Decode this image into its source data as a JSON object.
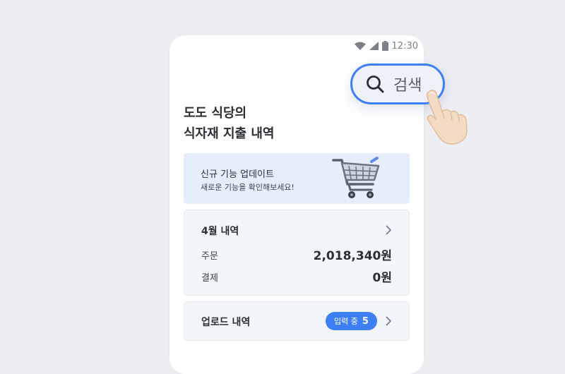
{
  "status_bar": {
    "time": "12:30",
    "icons": [
      "wifi-icon",
      "signal-icon",
      "battery-icon"
    ]
  },
  "header": {
    "title_line1": "도도 식당의",
    "title_line2": "식자재 지출 내역"
  },
  "banner": {
    "title": "신규 기능 업데이트",
    "subtitle": "새로운 기능을 확인해보세요!",
    "icon": "shopping-cart-icon"
  },
  "april_card": {
    "title": "4월 내역",
    "rows": [
      {
        "label": "주문",
        "value": "2,018,340원"
      },
      {
        "label": "결제",
        "value": "0원"
      }
    ]
  },
  "upload_card": {
    "title": "업로드 내역",
    "badge_label": "입력 중",
    "badge_count": "5"
  },
  "search_button": {
    "label": "검색",
    "icon": "search-icon"
  },
  "colors": {
    "accent": "#3d7ff5",
    "banner_bg": "#e6eefb",
    "card_bg": "#f2f5f9",
    "page_bg": "#eceef2"
  }
}
